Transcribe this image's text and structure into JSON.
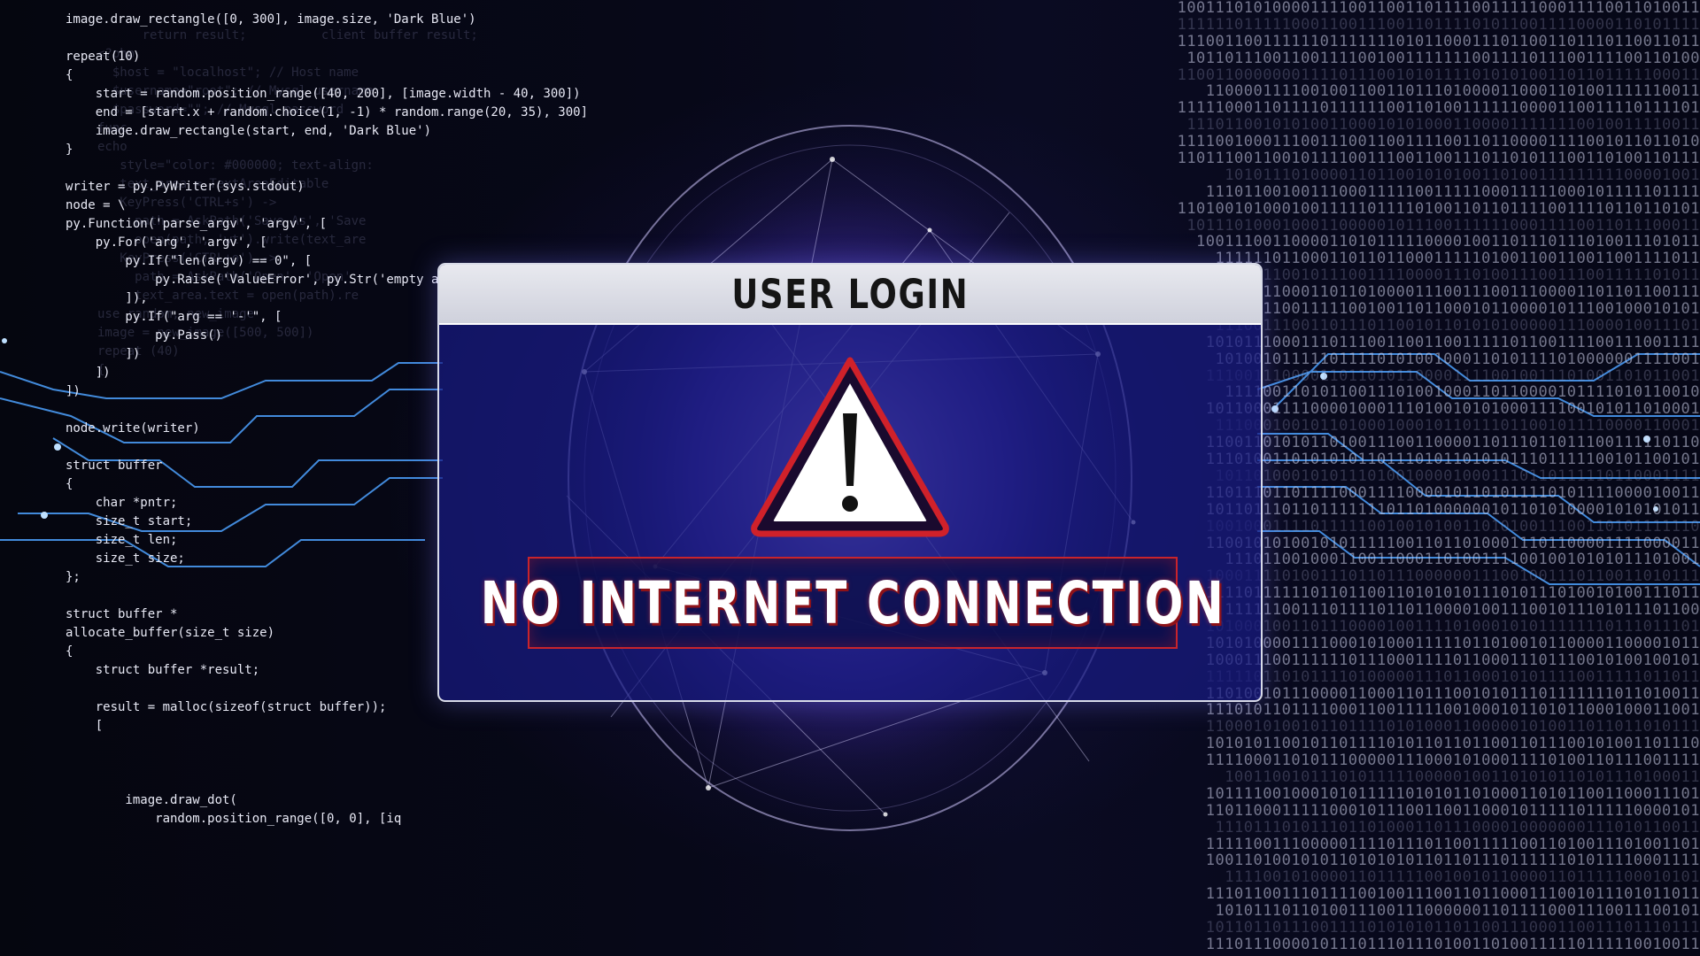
{
  "dialog": {
    "title": "USER LOGIN",
    "error_message": "NO INTERNET CONNECTION",
    "icon": "warning-triangle-icon"
  },
  "code_lines": [
    "image.draw_rectangle([0, 300], image.size, 'Dark Blue')",
    "",
    "repeat(10)",
    "{",
    "    start = random.position_range([40, 200], [image.width - 40, 300])",
    "    end = [start.x + random.choice(1, -1) * random.range(20, 35), 300]",
    "    image.draw_rectangle(start, end, 'Dark Blue')",
    "}",
    "",
    "writer = py.PyWriter(sys.stdout)",
    "node = \\",
    "py.Function('parse_argv', 'argv', [",
    "    py.For('arg', 'argv', [",
    "        py.If(\"len(argv) == 0\", [",
    "            py.Raise('ValueError', py.Str('empty arg",
    "        ]),",
    "        py.If(\"arg == '-'\", [",
    "            py.Pass()",
    "        ])",
    "    ])",
    "])",
    "",
    "node.write(writer)",
    "",
    "struct buffer",
    "{",
    "    char *pntr;",
    "    size_t start;",
    "    size_t len;",
    "    size_t size;",
    "};",
    "",
    "struct buffer *",
    "allocate_buffer(size_t size)",
    "{",
    "    struct buffer *result;",
    "",
    "    result = malloc(sizeof(struct buffer));",
    "    [",
    "",
    "",
    "",
    "        image.draw_dot(",
    "            random.position_range([0, 0], [iq"
  ],
  "ghost_code_lines": [
    "      return result;          client buffer result;",
    "",
    "",
    "",
    "",
    "",
    "<?php",
    "  $host = \"localhost\"; // Host name",
    "  $username=\"root\"; // Mysql username",
    "  $password=\"\"; // Mysql password",
    "func",
    "echo",
    "   style=\"color: #000000; text-align:",
    "",
    "",
    "",
    "",
    "",
    "   text_area = TextAreaEditable",
    "   KeyPress('CTRL+s') ->",
    "     path = AskPath('Save As', 'Save",
    "     open(path, 'wt').write(text_are",
    "",
    "",
    "   KeyPress('CTRL+o') ->",
    "     path = AskPath('Open', 'Open'",
    "     text_area.text = open(path).re",
    "",
    "",
    "",
    "",
    "",
    "use random, new_image",
    "",
    "image = new_image([500, 500])",
    "",
    "",
    "",
    "repeat (40)",
    "{"
  ],
  "binary_lines": [
    "1001110101000011110011001101111001111100011110011010011",
    "1111110111110001100111001101111010110011110000110101111",
    "1110011001111110111111101011000111011001101110110011011",
    "101101110011001111001001111111001111011100111100110100",
    "1100110000000111101110010101111010101001101101111100011",
    "1100001111001001100110111010000110001101001111110011",
    "1111100011011110111111001101001111110000110011110111101",
    "111011001010100110001010100011000011111110010011110011",
    "1111001000111001110011001111001101100001111001011011010",
    "1101110011001011110011100110011101101011100110100110111",
    "10101110100001101100101010011010011111111100001001",
    "1110110010011100011111001111100011111000101111101111",
    "1101001010001001111101111010011011011110011110110110101",
    "101110100010001100000101110011111100011110011011100011",
    "10011100110000110101111100001001101110111010011101011",
    "111111011000110110110001111101001100110011001111011",
    "1110001100101110011110000111010011100111001111101011",
    "10001101100011011010000111001110011100001101101100111",
    "1111001100111110010011011000101100001011100100010101",
    "111001110011011101100101101010100000111000010011101",
    "1010111000111011100110011001111101100111100111001111",
    "101001011111011110101001000110101111010000001111001",
    "1110011100001101101011000011110010011101001101011001",
    "11110011010110011101001000110110000101111010110010",
    "1011000111100001000111010010101000111100101011010001",
    "111000100101101000100010110111011001011110000110001",
    "1100110101011010011100110000110111011011100111110110",
    "1110100110101010110111010110101011101111100101100101",
    "101101000101011101001000010001110110111110110001111",
    "1101110110111100011110000101101011110101111000010011",
    "1011011101101111111011010000001011010100001010101011",
    "1001000111101111100100101001101010011100110101111110",
    "1100101010010101111100110110100011101100001111000011",
    "11101100100011001100011010011110010010101011101001",
    "1000111101001110110111000000111001001110110011010111",
    "1111011111101101100110101010111010111010010100111011",
    "11111100111011110110110000100111001011101011101100",
    "1010001001101110000100111101000101011111110111011101",
    "1010100001111000101000111110110100101100001100001011",
    "1000111001111110111000111101100011101110010100100101",
    "1111101101011110100000111011000101011110011111011011",
    "1101001011100001100011011100101011101111111011010011",
    "1110101101111000110011111001000101101011000100011001",
    "1100010100101101111010100011000001010011011011010111",
    "1010101100101101111010110110110011011100101001101110",
    "1111000110101110000011100010100011110100110111001111",
    "10011001011101011111000001001101010110101110100011",
    "1011110010001010111110101011010001101011001100011101",
    "1101100011111000101110011001100010111110111110000101",
    "111011101011101101000110111000010000000111010110011",
    "1111100111000001111011101100111110011010011101001101",
    "1001101001010110101010110110111011111101011110001111",
    "11110010100001101111100100101100001101111100010101",
    "1110110011101111001001110011011000111001011101011011",
    "101011101101001110011100000011011110001110011100101",
    "1011011011100111101010101101100111000110011101110111",
    "1110111000010111011101110100110100111110111110010011"
  ],
  "colors": {
    "dialog_fill": "#1a1c82",
    "header_fill": "#dcdde6",
    "alert_red": "#d0212a",
    "circuit_glow": "#3b8cff"
  }
}
